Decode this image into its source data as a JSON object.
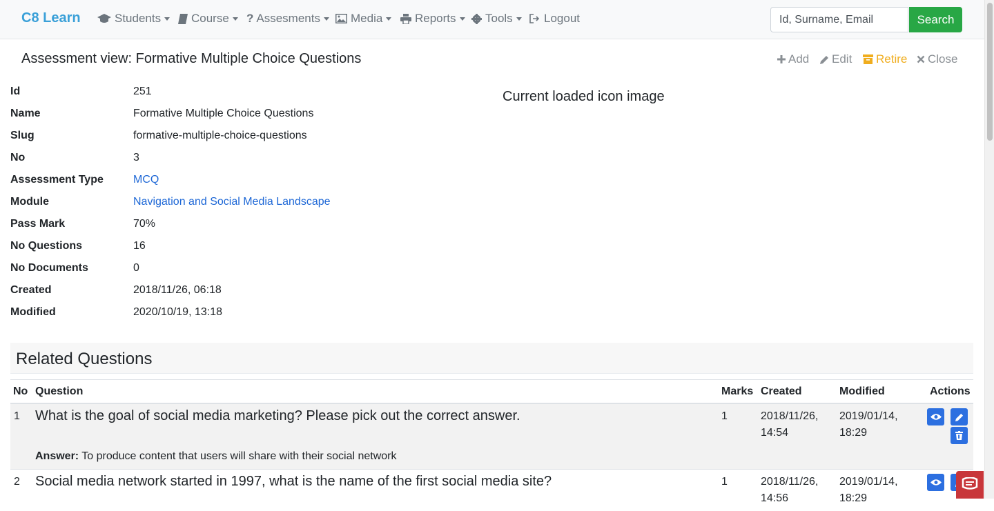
{
  "nav": {
    "brand": "C8 Learn",
    "items": [
      {
        "label": "Students",
        "icon": "graduation-cap-icon",
        "dropdown": true
      },
      {
        "label": "Course",
        "icon": "book-icon",
        "dropdown": true
      },
      {
        "label": "Assesments",
        "icon": "question-icon",
        "dropdown": true
      },
      {
        "label": "Media",
        "icon": "image-icon",
        "dropdown": true
      },
      {
        "label": "Reports",
        "icon": "print-icon",
        "dropdown": true
      },
      {
        "label": "Tools",
        "icon": "gear-icon",
        "dropdown": true
      },
      {
        "label": "Logout",
        "icon": "sign-out-icon",
        "dropdown": false
      }
    ],
    "search_placeholder": "Id, Surname, Email",
    "search_button": "Search"
  },
  "page": {
    "title": "Assessment view: Formative Multiple Choice Questions",
    "actions": {
      "add": "Add",
      "edit": "Edit",
      "retire": "Retire",
      "close": "Close"
    }
  },
  "details": {
    "labels": {
      "id": "Id",
      "name": "Name",
      "slug": "Slug",
      "no": "No",
      "assessment_type": "Assessment Type",
      "module": "Module",
      "pass_mark": "Pass Mark",
      "no_questions": "No Questions",
      "no_documents": "No Documents",
      "created": "Created",
      "modified": "Modified"
    },
    "values": {
      "id": "251",
      "name": "Formative Multiple Choice Questions",
      "slug": "formative-multiple-choice-questions",
      "no": "3",
      "assessment_type": "MCQ",
      "module": "Navigation and Social Media Landscape",
      "pass_mark": "70%",
      "no_questions": "16",
      "no_documents": "0",
      "created": "2018/11/26, 06:18",
      "modified": "2020/10/19, 13:18"
    },
    "icon_caption": "Current loaded icon image"
  },
  "related": {
    "title": "Related Questions",
    "headers": {
      "no": "No",
      "question": "Question",
      "marks": "Marks",
      "created": "Created",
      "modified": "Modified",
      "actions": "Actions"
    },
    "answer_label": "Answer:",
    "rows": [
      {
        "no": "1",
        "question": "What is the goal of social media marketing? Please pick out the correct answer.",
        "answer": "To produce content that users will share with their social network",
        "marks": "1",
        "created_date": "2018/11/26,",
        "created_time": "14:54",
        "modified_date": "2019/01/14,",
        "modified_time": "18:29"
      },
      {
        "no": "2",
        "question": "Social media network started in 1997, what is the name of the first social media site?",
        "marks": "1",
        "created_date": "2018/11/26,",
        "created_time": "14:56",
        "modified_date": "2019/01/14,",
        "modified_time": "18:29"
      }
    ]
  },
  "colors": {
    "brand": "#3aa0d8",
    "search_button": "#28a745",
    "link": "#1d67d6",
    "retire": "#f0ad1e",
    "action_button": "#2c6fe0"
  }
}
